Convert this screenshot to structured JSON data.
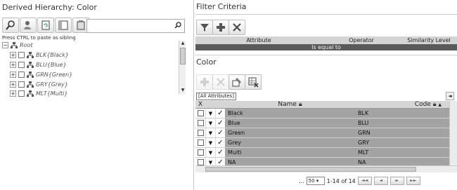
{
  "left_pane": {
    "title": "Derived Hierarchy: Color",
    "toolbar_icons": [
      "pin-icon",
      "user-search-icon",
      "refresh-doc-icon",
      "panel-icon",
      "clipboard-icon"
    ],
    "search": {
      "value": "",
      "placeholder": ""
    },
    "paste_hint": "Press CTRL to paste as sibling",
    "tree": {
      "root_label": "Root",
      "items": [
        {
          "label": "BLK{Black}"
        },
        {
          "label": "BLU{Blue}"
        },
        {
          "label": "GRN{Green}"
        },
        {
          "label": "GRY{Grey}"
        },
        {
          "label": "MLT{Multi}"
        }
      ]
    }
  },
  "filter": {
    "title": "Filter Criteria",
    "columns": [
      "Attribute",
      "Operator",
      "Similarity Level"
    ],
    "row": {
      "operator": "Is equal to"
    }
  },
  "color": {
    "title": "Color",
    "attr_filter": "[All Attributes]",
    "columns": {
      "x": "X",
      "name": "Name",
      "code": "Code"
    },
    "rows": [
      {
        "name": "Black",
        "code": "BLK"
      },
      {
        "name": "Blue",
        "code": "BLU"
      },
      {
        "name": "Green",
        "code": "GRN"
      },
      {
        "name": "Grey",
        "code": "GRY"
      },
      {
        "name": "Multi",
        "code": "MLT"
      },
      {
        "name": "NA",
        "code": "NA"
      }
    ],
    "pager": {
      "ellipsis": "...",
      "page_size": "50",
      "range": "1-14 of 14"
    }
  }
}
